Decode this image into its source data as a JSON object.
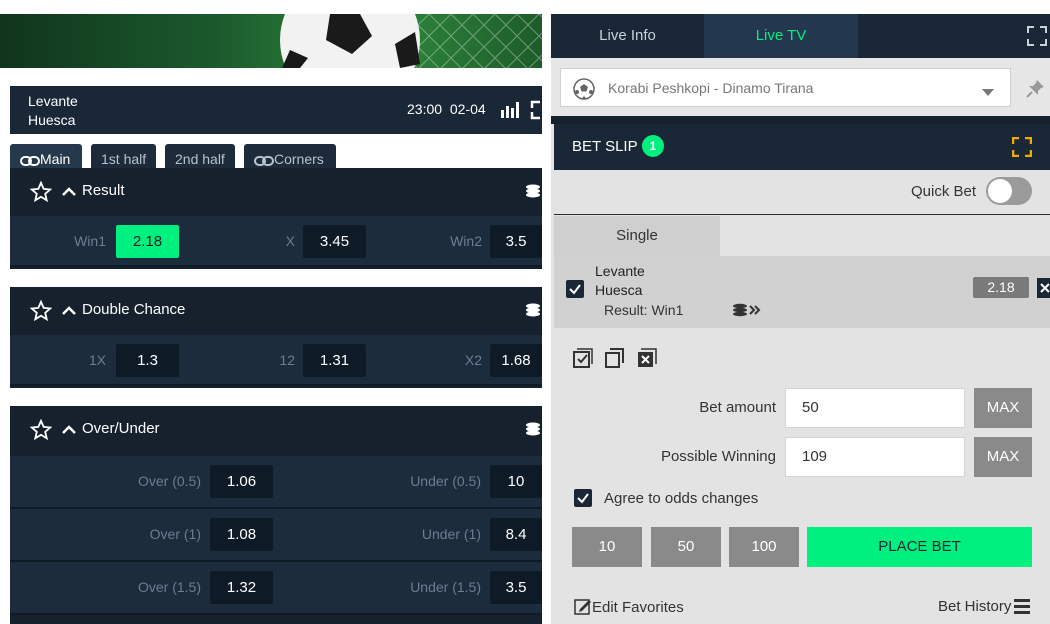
{
  "match": {
    "team_home": "Levante",
    "team_away": "Huesca",
    "time": "23:00",
    "date": "02-04"
  },
  "tabs": [
    {
      "label": "Main",
      "icon": "link-icon",
      "active": true
    },
    {
      "label": "1st half"
    },
    {
      "label": "2nd half"
    },
    {
      "label": "Corners",
      "icon": "link-icon"
    }
  ],
  "markets": {
    "result": {
      "title": "Result",
      "odds": [
        {
          "label": "Win1",
          "value": "2.18",
          "selected": true
        },
        {
          "label": "X",
          "value": "3.45"
        },
        {
          "label": "Win2",
          "value": "3.5"
        }
      ]
    },
    "double_chance": {
      "title": "Double Chance",
      "odds": [
        {
          "label": "1X",
          "value": "1.3"
        },
        {
          "label": "12",
          "value": "1.31"
        },
        {
          "label": "X2",
          "value": "1.68"
        }
      ]
    },
    "over_under": {
      "title": "Over/Under",
      "rows": [
        {
          "over_label": "Over (0.5)",
          "over_value": "1.06",
          "under_label": "Under (0.5)",
          "under_value": "10"
        },
        {
          "over_label": "Over (1)",
          "over_value": "1.08",
          "under_label": "Under (1)",
          "under_value": "8.4"
        },
        {
          "over_label": "Over (1.5)",
          "over_value": "1.32",
          "under_label": "Under (1.5)",
          "under_value": "3.5"
        }
      ]
    }
  },
  "right_nav": {
    "live_info": "Live Info",
    "live_tv": "Live TV"
  },
  "stream_select": {
    "value": "Korabi Peshkopi - Dinamo Tirana"
  },
  "betslip": {
    "title": "BET SLIP",
    "count": "1",
    "quick_bet_label": "Quick Bet",
    "single_tab": "Single",
    "item": {
      "team_home": "Levante",
      "team_away": "Huesca",
      "result": "Result: Win1",
      "odd": "2.18"
    },
    "bet_amount_label": "Bet amount",
    "bet_amount_value": "50",
    "possible_winning_label": "Possible Winning",
    "possible_winning_value": "109",
    "max_label": "MAX",
    "agree_label": "Agree to odds changes",
    "quick_amounts": [
      "10",
      "50",
      "100"
    ],
    "place_bet_label": "PLACE BET",
    "edit_favorites_label": "Edit Favorites",
    "bet_history_label": "Bet History"
  },
  "colors": {
    "accent": "#00f07f",
    "dark_bg": "#16212d",
    "row_bg": "#1c2c3d",
    "odd_bg": "#0e1a26",
    "panel_bg": "#e3e3e3",
    "expand_accent": "#f2a900"
  }
}
